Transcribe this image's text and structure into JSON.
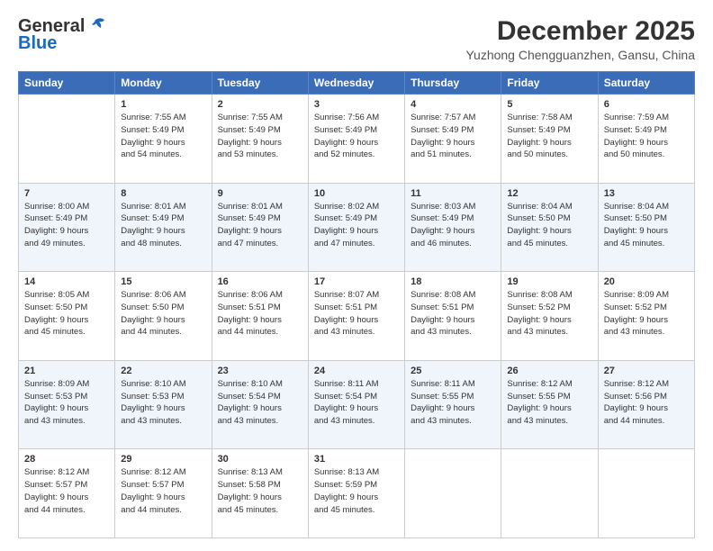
{
  "header": {
    "logo_general": "General",
    "logo_blue": "Blue",
    "month_title": "December 2025",
    "location": "Yuzhong Chengguanzhen, Gansu, China"
  },
  "weekdays": [
    "Sunday",
    "Monday",
    "Tuesday",
    "Wednesday",
    "Thursday",
    "Friday",
    "Saturday"
  ],
  "weeks": [
    [
      {
        "day": "",
        "info": ""
      },
      {
        "day": "1",
        "info": "Sunrise: 7:55 AM\nSunset: 5:49 PM\nDaylight: 9 hours\nand 54 minutes."
      },
      {
        "day": "2",
        "info": "Sunrise: 7:55 AM\nSunset: 5:49 PM\nDaylight: 9 hours\nand 53 minutes."
      },
      {
        "day": "3",
        "info": "Sunrise: 7:56 AM\nSunset: 5:49 PM\nDaylight: 9 hours\nand 52 minutes."
      },
      {
        "day": "4",
        "info": "Sunrise: 7:57 AM\nSunset: 5:49 PM\nDaylight: 9 hours\nand 51 minutes."
      },
      {
        "day": "5",
        "info": "Sunrise: 7:58 AM\nSunset: 5:49 PM\nDaylight: 9 hours\nand 50 minutes."
      },
      {
        "day": "6",
        "info": "Sunrise: 7:59 AM\nSunset: 5:49 PM\nDaylight: 9 hours\nand 50 minutes."
      }
    ],
    [
      {
        "day": "7",
        "info": "Sunrise: 8:00 AM\nSunset: 5:49 PM\nDaylight: 9 hours\nand 49 minutes."
      },
      {
        "day": "8",
        "info": "Sunrise: 8:01 AM\nSunset: 5:49 PM\nDaylight: 9 hours\nand 48 minutes."
      },
      {
        "day": "9",
        "info": "Sunrise: 8:01 AM\nSunset: 5:49 PM\nDaylight: 9 hours\nand 47 minutes."
      },
      {
        "day": "10",
        "info": "Sunrise: 8:02 AM\nSunset: 5:49 PM\nDaylight: 9 hours\nand 47 minutes."
      },
      {
        "day": "11",
        "info": "Sunrise: 8:03 AM\nSunset: 5:49 PM\nDaylight: 9 hours\nand 46 minutes."
      },
      {
        "day": "12",
        "info": "Sunrise: 8:04 AM\nSunset: 5:50 PM\nDaylight: 9 hours\nand 45 minutes."
      },
      {
        "day": "13",
        "info": "Sunrise: 8:04 AM\nSunset: 5:50 PM\nDaylight: 9 hours\nand 45 minutes."
      }
    ],
    [
      {
        "day": "14",
        "info": "Sunrise: 8:05 AM\nSunset: 5:50 PM\nDaylight: 9 hours\nand 45 minutes."
      },
      {
        "day": "15",
        "info": "Sunrise: 8:06 AM\nSunset: 5:50 PM\nDaylight: 9 hours\nand 44 minutes."
      },
      {
        "day": "16",
        "info": "Sunrise: 8:06 AM\nSunset: 5:51 PM\nDaylight: 9 hours\nand 44 minutes."
      },
      {
        "day": "17",
        "info": "Sunrise: 8:07 AM\nSunset: 5:51 PM\nDaylight: 9 hours\nand 43 minutes."
      },
      {
        "day": "18",
        "info": "Sunrise: 8:08 AM\nSunset: 5:51 PM\nDaylight: 9 hours\nand 43 minutes."
      },
      {
        "day": "19",
        "info": "Sunrise: 8:08 AM\nSunset: 5:52 PM\nDaylight: 9 hours\nand 43 minutes."
      },
      {
        "day": "20",
        "info": "Sunrise: 8:09 AM\nSunset: 5:52 PM\nDaylight: 9 hours\nand 43 minutes."
      }
    ],
    [
      {
        "day": "21",
        "info": "Sunrise: 8:09 AM\nSunset: 5:53 PM\nDaylight: 9 hours\nand 43 minutes."
      },
      {
        "day": "22",
        "info": "Sunrise: 8:10 AM\nSunset: 5:53 PM\nDaylight: 9 hours\nand 43 minutes."
      },
      {
        "day": "23",
        "info": "Sunrise: 8:10 AM\nSunset: 5:54 PM\nDaylight: 9 hours\nand 43 minutes."
      },
      {
        "day": "24",
        "info": "Sunrise: 8:11 AM\nSunset: 5:54 PM\nDaylight: 9 hours\nand 43 minutes."
      },
      {
        "day": "25",
        "info": "Sunrise: 8:11 AM\nSunset: 5:55 PM\nDaylight: 9 hours\nand 43 minutes."
      },
      {
        "day": "26",
        "info": "Sunrise: 8:12 AM\nSunset: 5:55 PM\nDaylight: 9 hours\nand 43 minutes."
      },
      {
        "day": "27",
        "info": "Sunrise: 8:12 AM\nSunset: 5:56 PM\nDaylight: 9 hours\nand 44 minutes."
      }
    ],
    [
      {
        "day": "28",
        "info": "Sunrise: 8:12 AM\nSunset: 5:57 PM\nDaylight: 9 hours\nand 44 minutes."
      },
      {
        "day": "29",
        "info": "Sunrise: 8:12 AM\nSunset: 5:57 PM\nDaylight: 9 hours\nand 44 minutes."
      },
      {
        "day": "30",
        "info": "Sunrise: 8:13 AM\nSunset: 5:58 PM\nDaylight: 9 hours\nand 45 minutes."
      },
      {
        "day": "31",
        "info": "Sunrise: 8:13 AM\nSunset: 5:59 PM\nDaylight: 9 hours\nand 45 minutes."
      },
      {
        "day": "",
        "info": ""
      },
      {
        "day": "",
        "info": ""
      },
      {
        "day": "",
        "info": ""
      }
    ]
  ]
}
